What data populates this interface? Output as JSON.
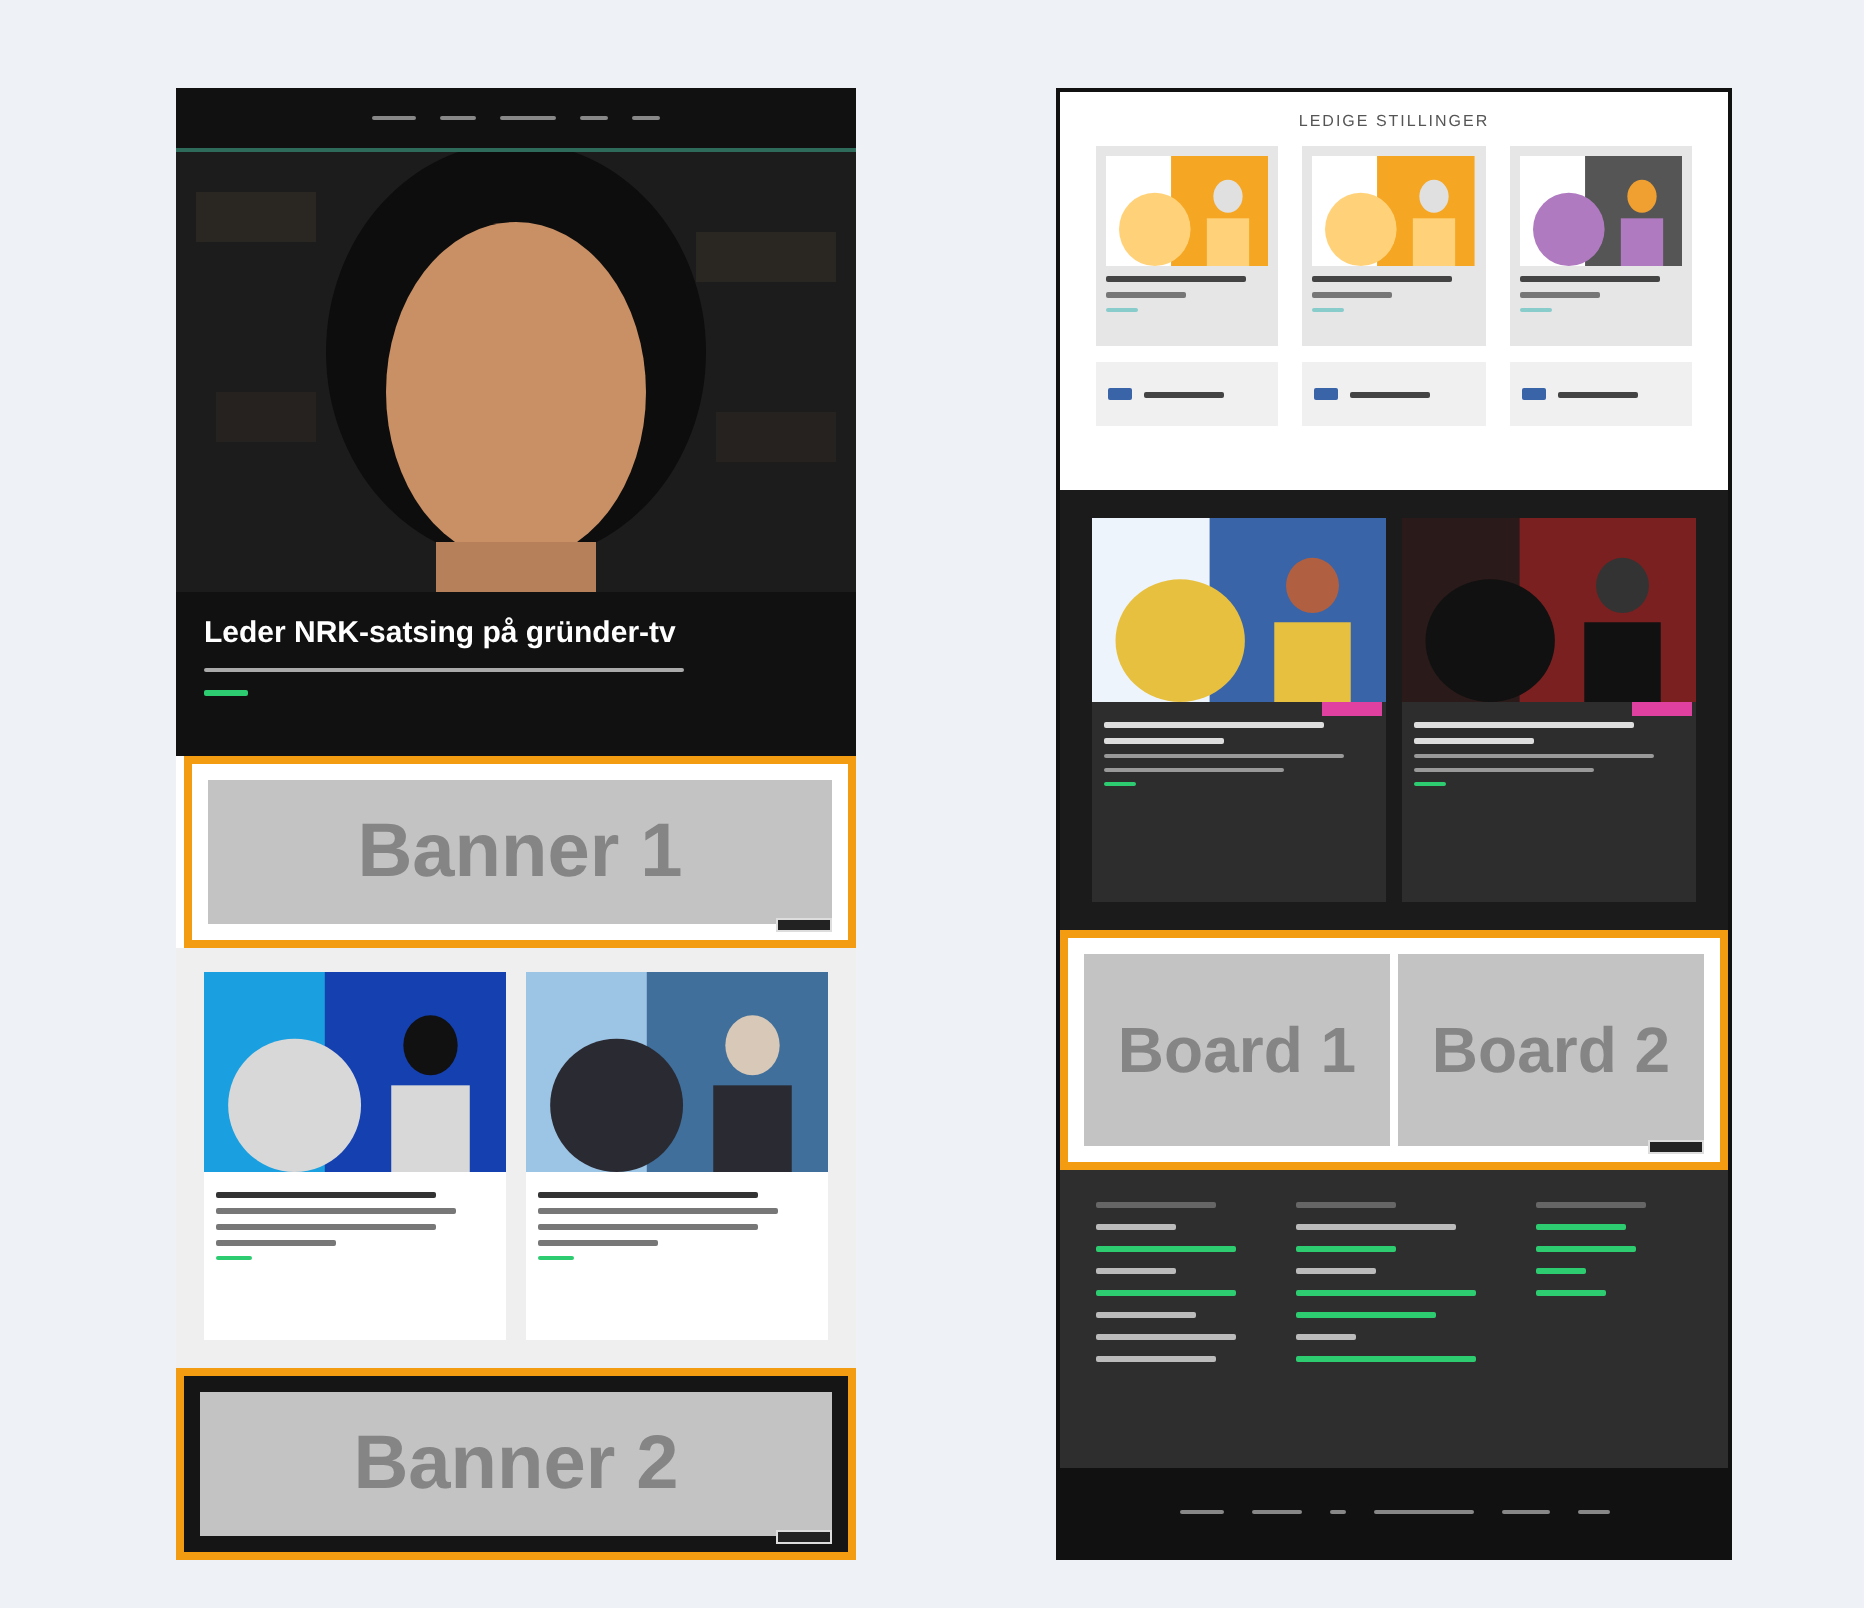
{
  "left_page": {
    "hero": {
      "headline": "Leder NRK-satsing på gründer-tv"
    },
    "banners": [
      {
        "label": "Banner 1"
      },
      {
        "label": "Banner 2"
      }
    ]
  },
  "right_page": {
    "section_title": "LEDIGE STILLINGER",
    "boards": [
      {
        "label": "Board 1"
      },
      {
        "label": "Board 2"
      }
    ]
  }
}
